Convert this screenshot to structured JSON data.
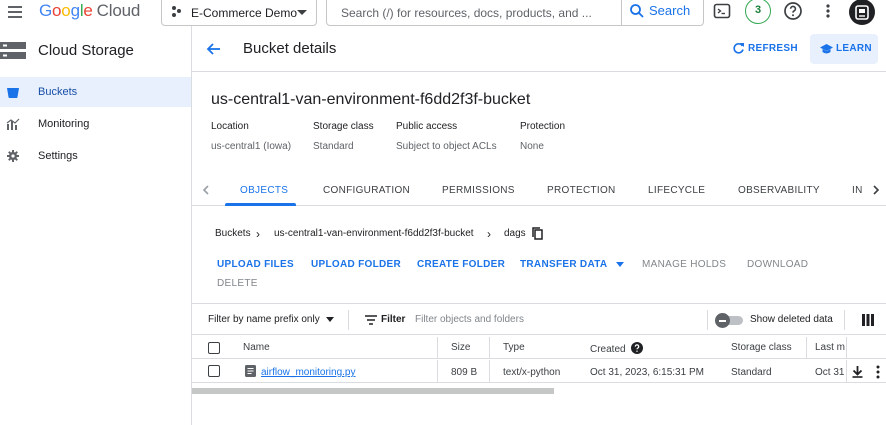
{
  "topbar": {
    "logo_letters": [
      "G",
      "o",
      "o",
      "g",
      "l",
      "e"
    ],
    "logo_suffix": "Cloud",
    "project": "E-Commerce Demo",
    "search_placeholder": "Search (/) for resources, docs, products, and ...",
    "search_button": "Search",
    "notifications_count": "3"
  },
  "sidenav": {
    "title": "Cloud Storage",
    "items": [
      {
        "label": "Buckets",
        "icon": "bucket-icon",
        "active": true
      },
      {
        "label": "Monitoring",
        "icon": "bar-chart-icon",
        "active": false
      },
      {
        "label": "Settings",
        "icon": "gear-icon",
        "active": false
      }
    ]
  },
  "header": {
    "title": "Bucket details",
    "refresh_label": "REFRESH",
    "learn_label": "LEARN"
  },
  "bucket": {
    "name": "us-central1-van-environment-f6dd2f3f-bucket",
    "location_label": "Location",
    "location_value": "us-central1 (Iowa)",
    "storage_class_label": "Storage class",
    "storage_class_value": "Standard",
    "public_access_label": "Public access",
    "public_access_value": "Subject to object ACLs",
    "protection_label": "Protection",
    "protection_value": "None"
  },
  "tabs": [
    "OBJECTS",
    "CONFIGURATION",
    "PERMISSIONS",
    "PROTECTION",
    "LIFECYCLE",
    "OBSERVABILITY",
    "IN"
  ],
  "active_tab": "OBJECTS",
  "breadcrumb": [
    "Buckets",
    "us-central1-van-environment-f6dd2f3f-bucket",
    "dags"
  ],
  "actions": {
    "upload_files": "UPLOAD FILES",
    "upload_folder": "UPLOAD FOLDER",
    "create_folder": "CREATE FOLDER",
    "transfer_data": "TRANSFER DATA",
    "manage_holds": "MANAGE HOLDS",
    "download": "DOWNLOAD",
    "delete": "DELETE"
  },
  "filterbar": {
    "prefix_select": "Filter by name prefix only",
    "filter_label": "Filter",
    "filter_placeholder": "Filter objects and folders",
    "show_deleted": "Show deleted data"
  },
  "table": {
    "columns": [
      "Name",
      "Size",
      "Type",
      "Created",
      "Storage class",
      "Last m"
    ],
    "rows": [
      {
        "name": "airflow_monitoring.py",
        "size": "809 B",
        "type": "text/x-python",
        "created": "Oct 31, 2023, 6:15:31 PM",
        "storage_class": "Standard",
        "last_modified": "Oct 31"
      }
    ]
  },
  "colors": {
    "accent": "#1a73e8",
    "active_nav_bg": "#e8f0fe",
    "border": "#dadce0"
  }
}
